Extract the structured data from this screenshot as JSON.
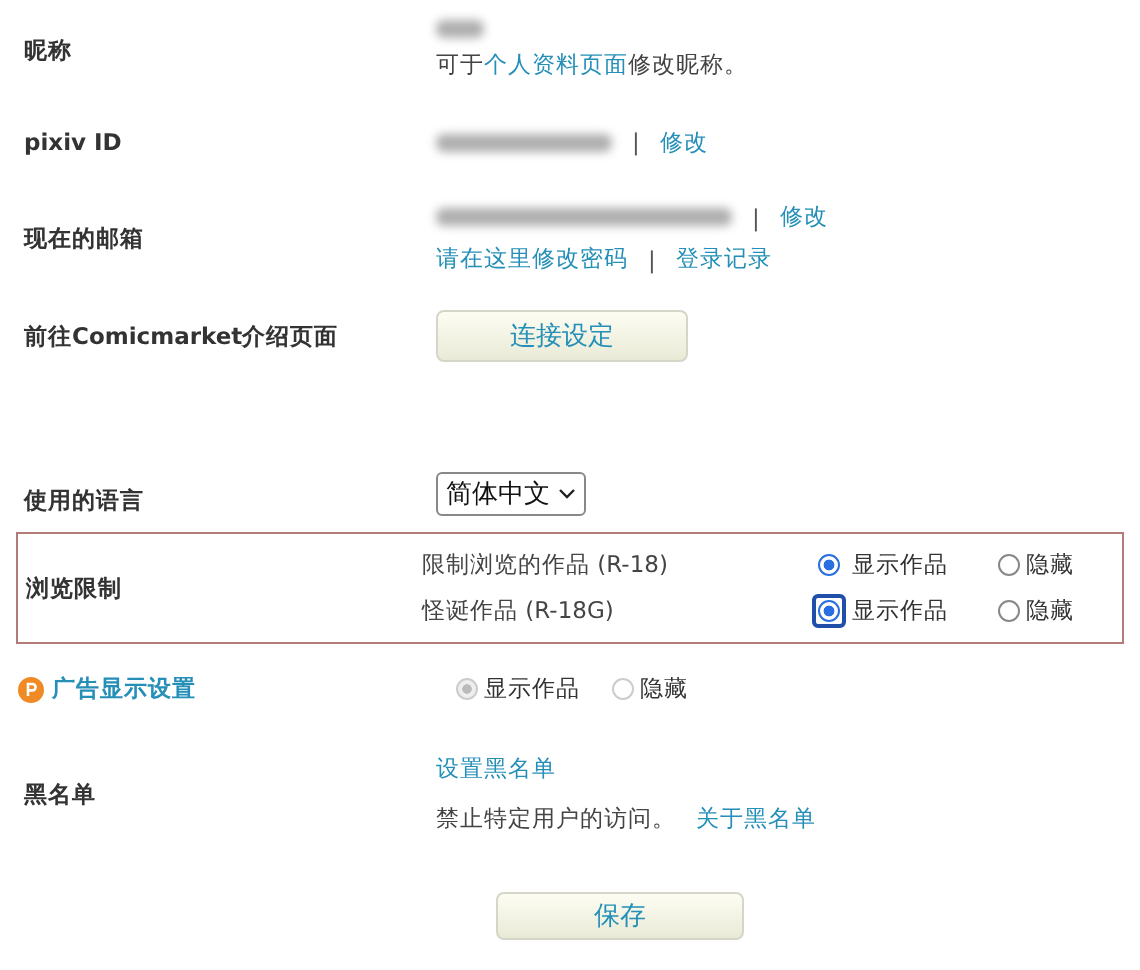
{
  "nickname": {
    "label": "昵称",
    "hint_before": "可于",
    "hint_link": "个人资料页面",
    "hint_after": "修改昵称。"
  },
  "pixiv_id": {
    "label": "pixiv ID",
    "edit_link": "修改",
    "separator": "|"
  },
  "email": {
    "label": "现在的邮箱",
    "edit_link": "修改",
    "separator": "|",
    "password_link": "请在这里修改密码",
    "separator_2": "|",
    "login_log_link": "登录记录"
  },
  "comicmarket": {
    "label": "前往Comicmarket介绍页面",
    "button": "连接设定"
  },
  "language": {
    "label": "使用的语言",
    "value": "简体中文"
  },
  "browse_limit": {
    "label": "浏览限制",
    "rows": [
      {
        "name": "限制浏览的作品 (R-18)",
        "focused": false,
        "options": [
          {
            "label": "显示作品",
            "selected": true
          },
          {
            "label": "隐藏",
            "selected": false
          }
        ]
      },
      {
        "name": "怪诞作品 (R-18G)",
        "focused": true,
        "options": [
          {
            "label": "显示作品",
            "selected": true
          },
          {
            "label": "隐藏",
            "selected": false
          }
        ]
      }
    ]
  },
  "ads": {
    "label": "广告显示设置",
    "disabled": true,
    "options": [
      {
        "label": "显示作品",
        "selected": true
      },
      {
        "label": "隐藏",
        "selected": false
      }
    ]
  },
  "blacklist": {
    "label": "黑名单",
    "link": "设置黑名单",
    "note": "禁止特定用户的访问。",
    "about_link": "关于黑名单"
  },
  "save_button": "保存"
}
